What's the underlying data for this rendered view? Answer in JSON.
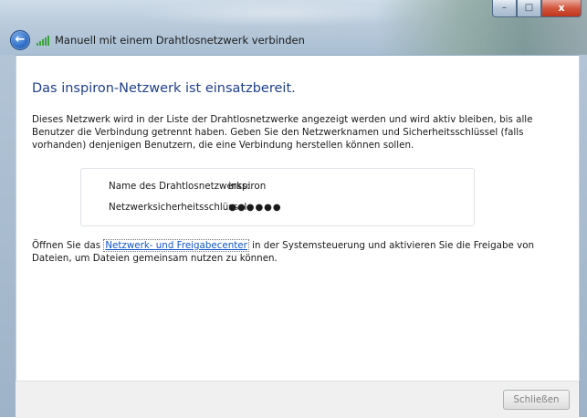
{
  "window": {
    "title": "Manuell mit einem Drahtlosnetzwerk verbinden",
    "caption": {
      "minimize": "–",
      "maximize": "□",
      "close": "x"
    }
  },
  "icons": {
    "back": "back-arrow-icon",
    "network": "wireless-signal-icon"
  },
  "main": {
    "heading": "Das inspiron-Netzwerk ist einsatzbereit.",
    "description": "Dieses Netzwerk wird in der Liste der Drahtlosnetzwerke angezeigt werden und wird aktiv bleiben, bis alle Benutzer die Verbindung getrennt haben. Geben Sie den Netzwerknamen und Sicherheitsschlüssel (falls vorhanden) denjenigen Benutzern, die eine Verbindung herstellen können sollen.",
    "info": {
      "name_label": "Name des Drahtlosnetzwerks:",
      "name_value": "inspiron",
      "key_label": "Netzwerksicherheitsschlüssel:",
      "key_value": "●●●●●●"
    },
    "bottom": {
      "prefix": "Öffnen Sie das ",
      "link": "Netzwerk- und Freigabecenter",
      "suffix": " in der Systemsteuerung und aktivieren Sie die Freigabe von Dateien, um Dateien gemeinsam nutzen zu können."
    }
  },
  "footer": {
    "close_label": "Schließen"
  },
  "colors": {
    "heading": "#1e3f8a",
    "link": "#1155cc",
    "close_caption": "#c0351c"
  }
}
